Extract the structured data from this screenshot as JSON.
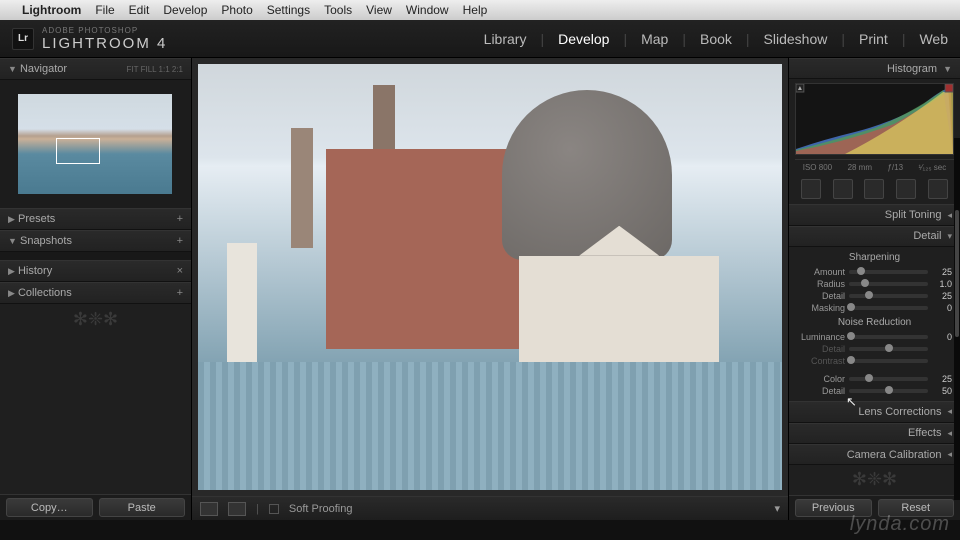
{
  "mac_menu": {
    "apple": "",
    "app": "Lightroom",
    "items": [
      "File",
      "Edit",
      "Develop",
      "Photo",
      "Settings",
      "Tools",
      "View",
      "Window",
      "Help"
    ]
  },
  "brand": {
    "sub": "ADOBE PHOTOSHOP",
    "main": "LIGHTROOM 4",
    "logo": "Lr"
  },
  "modules": {
    "items": [
      "Library",
      "Develop",
      "Map",
      "Book",
      "Slideshow",
      "Print",
      "Web"
    ],
    "active": "Develop"
  },
  "left": {
    "navigator": {
      "title": "Navigator",
      "zooms": "FIT  FILL  1:1  2:1"
    },
    "panels": [
      {
        "title": "Presets",
        "icon": "+"
      },
      {
        "title": "Snapshots",
        "icon": "+"
      },
      {
        "title": "History",
        "icon": "×"
      },
      {
        "title": "Collections",
        "icon": "+"
      }
    ],
    "copy": "Copy…",
    "paste": "Paste"
  },
  "right": {
    "histogram": "Histogram",
    "exif": {
      "iso": "ISO 800",
      "focal": "28 mm",
      "aperture": "ƒ/13",
      "shutter": "¹⁄₁₂₅ sec"
    },
    "splitToning": "Split Toning",
    "detail": "Detail",
    "sharpening": {
      "title": "Sharpening",
      "rows": [
        {
          "lbl": "Amount",
          "val": "25",
          "pos": 15
        },
        {
          "lbl": "Radius",
          "val": "1.0",
          "pos": 20
        },
        {
          "lbl": "Detail",
          "val": "25",
          "pos": 25
        },
        {
          "lbl": "Masking",
          "val": "0",
          "pos": 2
        }
      ]
    },
    "noise": {
      "title": "Noise Reduction",
      "rows": [
        {
          "lbl": "Luminance",
          "val": "0",
          "pos": 2,
          "dim": false
        },
        {
          "lbl": "Detail",
          "val": "",
          "pos": 50,
          "dim": true
        },
        {
          "lbl": "Contrast",
          "val": "",
          "pos": 2,
          "dim": true
        },
        {
          "lbl": "Color",
          "val": "25",
          "pos": 25,
          "dim": false
        },
        {
          "lbl": "Detail",
          "val": "50",
          "pos": 50,
          "dim": false
        }
      ]
    },
    "lensCorr": "Lens Corrections",
    "effects": "Effects",
    "camCal": "Camera Calibration",
    "previous": "Previous",
    "reset": "Reset"
  },
  "center": {
    "softProof": "Soft Proofing"
  },
  "watermark": "lynda.com"
}
